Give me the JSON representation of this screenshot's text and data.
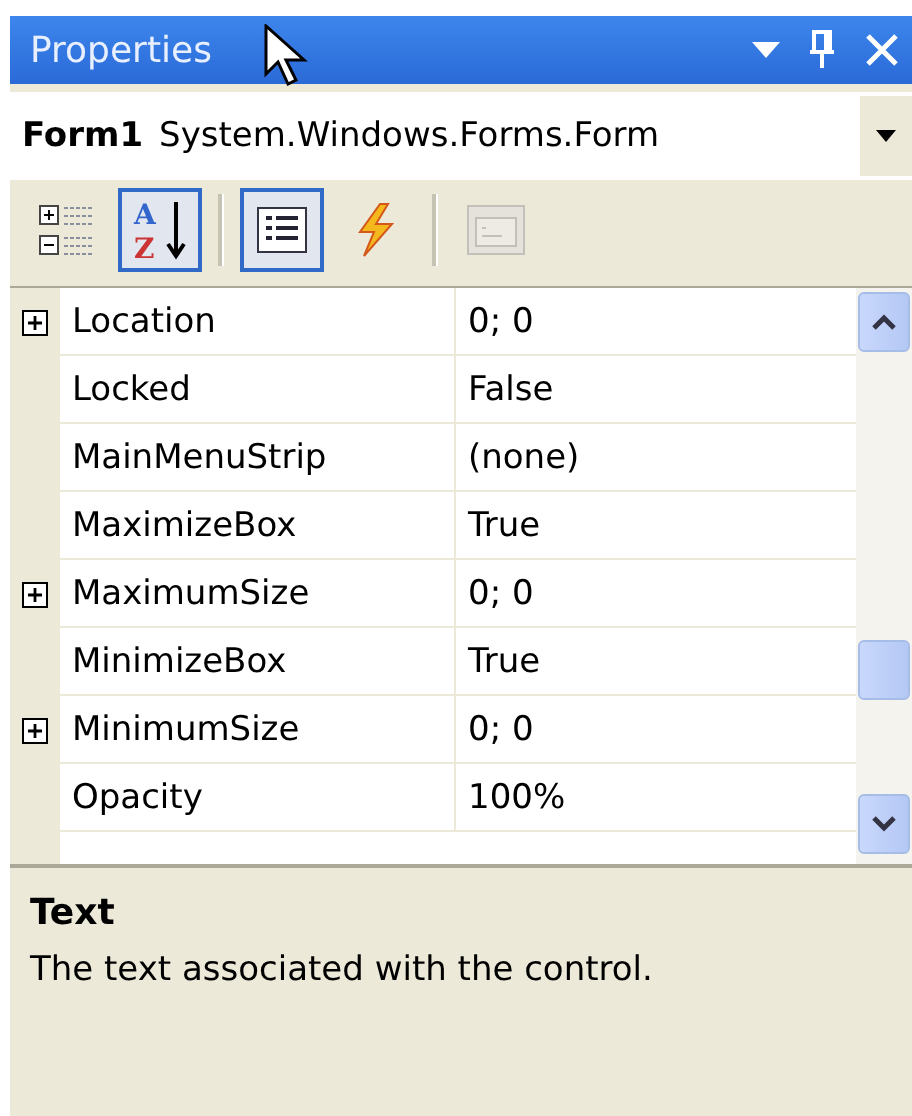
{
  "window": {
    "title": "Properties"
  },
  "object_selector": {
    "name": "Form1",
    "type": "System.Windows.Forms.Form"
  },
  "toolbar": [
    {
      "kind": "categorized",
      "selected": false,
      "disabled": false
    },
    {
      "kind": "alphabetical",
      "selected": true,
      "disabled": false,
      "letters": [
        "A",
        "Z"
      ]
    },
    {
      "kind": "separator"
    },
    {
      "kind": "properties",
      "selected": true,
      "disabled": false
    },
    {
      "kind": "events",
      "selected": false,
      "disabled": false
    },
    {
      "kind": "separator"
    },
    {
      "kind": "property_pages",
      "selected": false,
      "disabled": true
    }
  ],
  "properties": [
    {
      "kind": "group",
      "name": "Location",
      "value": "0; 0"
    },
    {
      "kind": "plain",
      "name": "Locked",
      "value": "False"
    },
    {
      "kind": "plain",
      "name": "MainMenuStrip",
      "value": "(none)"
    },
    {
      "kind": "plain",
      "name": "MaximizeBox",
      "value": "True"
    },
    {
      "kind": "group",
      "name": "MaximumSize",
      "value": "0; 0"
    },
    {
      "kind": "plain",
      "name": "MinimizeBox",
      "value": "True"
    },
    {
      "kind": "group",
      "name": "MinimumSize",
      "value": "0; 0"
    },
    {
      "kind": "plain",
      "name": "Opacity",
      "value": "100%"
    }
  ],
  "description": {
    "title": "Text",
    "text": "The text associated with the control."
  }
}
